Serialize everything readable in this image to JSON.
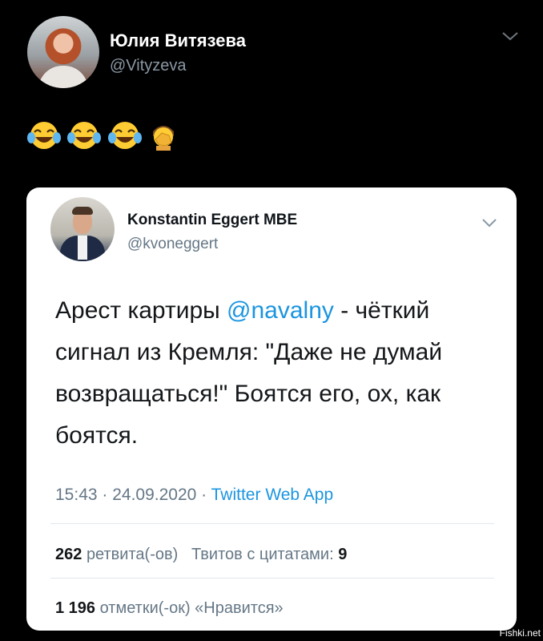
{
  "outer_tweet": {
    "author_name": "Юлия Витязева",
    "author_handle": "@Vityzeva",
    "emoji_icons": [
      "face-with-tears-of-joy-icon",
      "face-with-tears-of-joy-icon",
      "face-with-tears-of-joy-icon",
      "facepalm-icon"
    ]
  },
  "quoted_tweet": {
    "author_name": "Konstantin Eggert MBE",
    "author_handle": "@kvoneggert",
    "text_before": "Арест картиры ",
    "mention": "@navalny",
    "text_after": " - чёткий сигнал из Кремля: \"Даже не думай возвращаться!\" Боятся его, ох, как боятся.",
    "time": "15:43",
    "date": "24.09.2020",
    "separator": " · ",
    "source": "Twitter Web App",
    "retweets_count": "262",
    "retweets_label": "ретвита(-ов)",
    "quotes_label": "Твитов с цитатами:",
    "quotes_count": "9",
    "likes_count": "1 196",
    "likes_label": "отметки(-ок) «Нравится»"
  },
  "watermark": "Fishki.net",
  "colors": {
    "background": "#000000",
    "card": "#ffffff",
    "link": "#1b95e0",
    "muted": "#657786"
  }
}
